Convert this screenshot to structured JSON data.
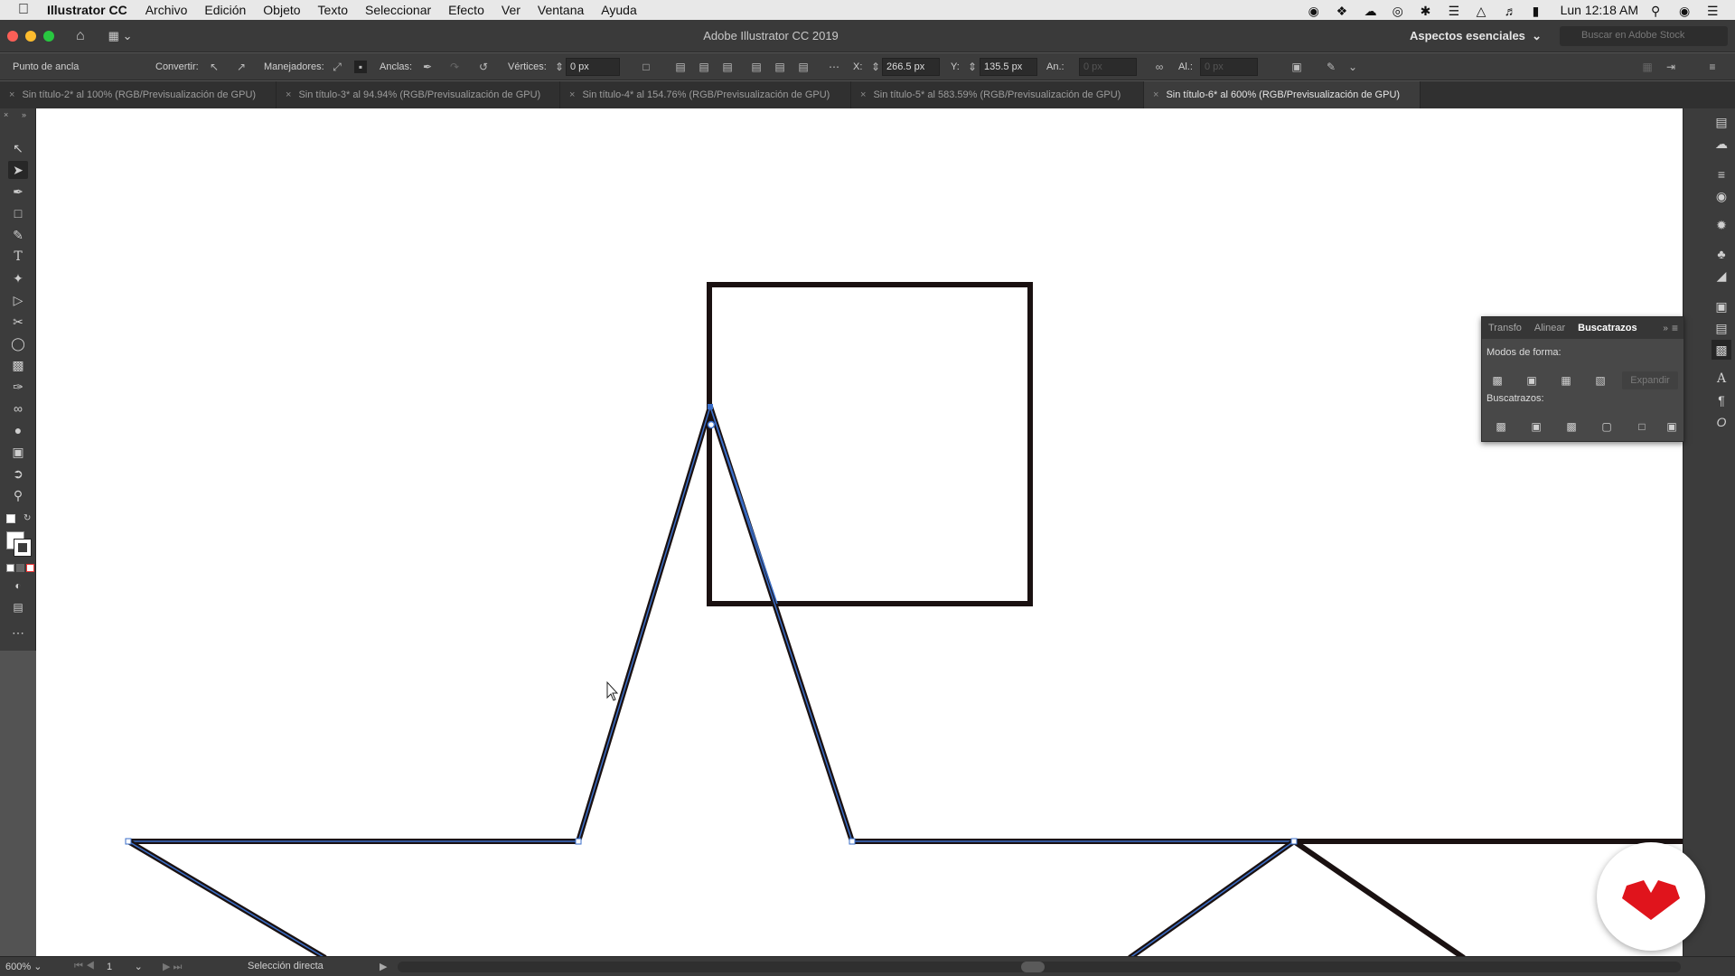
{
  "menubar": {
    "app_name": "Illustrator CC",
    "items": [
      "Archivo",
      "Edición",
      "Objeto",
      "Texto",
      "Seleccionar",
      "Efecto",
      "Ver",
      "Ventana",
      "Ayuda"
    ],
    "clock": "Lun 12:18 AM"
  },
  "window": {
    "title": "Adobe Illustrator CC 2019",
    "workspace": "Aspectos esenciales",
    "search_placeholder": "Buscar en Adobe Stock"
  },
  "control_bar": {
    "mode_label": "Punto de ancla",
    "convert_label": "Convertir:",
    "handles_label": "Manejadores:",
    "anchors_label": "Anclas:",
    "corners_label": "Vértices:",
    "corners_value": "0 px",
    "x_label": "X:",
    "x_value": "266.5 px",
    "y_label": "Y:",
    "y_value": "135.5 px",
    "w_label": "An.:",
    "w_value": "0 px",
    "h_label": "Al.:",
    "h_value": "0 px"
  },
  "tabs": [
    {
      "label": "Sin título-2* al 100% (RGB/Previsualización de GPU)",
      "active": false
    },
    {
      "label": "Sin título-3* al 94.94% (RGB/Previsualización de GPU)",
      "active": false
    },
    {
      "label": "Sin título-4* al 154.76% (RGB/Previsualización de GPU)",
      "active": false
    },
    {
      "label": "Sin título-5* al 583.59% (RGB/Previsualización de GPU)",
      "active": false
    },
    {
      "label": "Sin título-6* al 600% (RGB/Previsualización de GPU)",
      "active": true
    }
  ],
  "tools": [
    "selection-tool",
    "direct-selection-tool",
    "pen-tool",
    "rectangle-tool",
    "pencil-tool",
    "type-tool",
    "magic-wand-tool",
    "reflect-tool",
    "scissors-tool",
    "lasso-tool",
    "gradient-tool",
    "eyedropper-tool",
    "blend-tool",
    "shape-builder-tool",
    "artboard-tool",
    "pin-tool",
    "zoom-tool"
  ],
  "pathfinder_panel": {
    "tabs": [
      "Transfo",
      "Alinear",
      "Buscatrazos"
    ],
    "active_tab": "Buscatrazos",
    "shape_modes_label": "Modos de forma:",
    "pathfinders_label": "Buscatrazos:",
    "expand_label": "Expandir"
  },
  "statusbar": {
    "zoom": "600%",
    "artboard": "1",
    "status": "Selección directa"
  },
  "colors": {
    "stroke": "#1a1111",
    "selection": "#3a6ec8",
    "logo": "#e0141c"
  }
}
